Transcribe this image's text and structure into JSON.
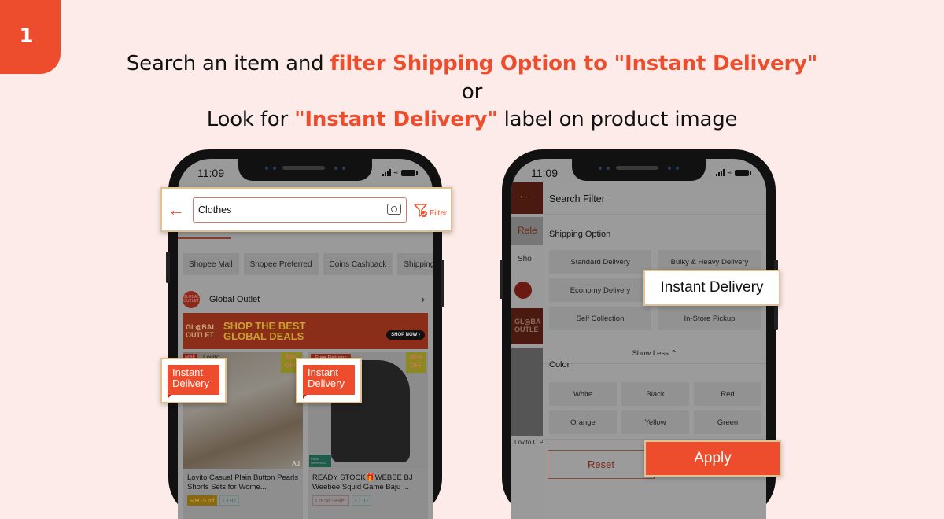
{
  "step": {
    "number": "1"
  },
  "headline": {
    "line1_a": "Search an item and ",
    "line1_b": "filter Shipping Option to \"Instant Delivery\"",
    "line2": "or",
    "line3_a": "Look for ",
    "line3_b": "\"Instant Delivery\"",
    "line3_c": " label on product image"
  },
  "colors": {
    "accent": "#ee4d2d",
    "background": "#fcebe8",
    "highlight_border": "#e1c193"
  },
  "left_phone": {
    "status": {
      "time": "11:09"
    },
    "search": {
      "back_icon": "arrow-left-icon",
      "value": "Clothes",
      "camera_icon": "camera-icon",
      "filter_label": "Filter"
    },
    "chips": [
      "Shopee Mall",
      "Shopee Preferred",
      "Coins Cashback",
      "Shipping O"
    ],
    "outlet": {
      "logo": "GLOBAL OUTLET",
      "name": "Global Outlet"
    },
    "banner": {
      "logo": "GL◎BAL OUTLET",
      "line1": "SHOP THE BEST",
      "line2": "GLOBAL DEALS",
      "cta": "SHOP NOW ›"
    },
    "products": [
      {
        "badge": "Mall",
        "brand": "Lovito",
        "discount": "35% OFF",
        "label": "Instant Delivery",
        "ad": "Ad",
        "title": "Lovito Casual Plain Button Pearls Shorts Sets for Wome...",
        "tags": [
          "RM15 off",
          "COD"
        ]
      },
      {
        "badge": "Free Returns",
        "discount": "85% OFF",
        "label": "Instant Delivery",
        "shipping_badge": "FREE SHIPPING",
        "title": "READY STOCK🎁WEBEE BJ Weebee Squid Game Baju ...",
        "tags": [
          "Local Seller",
          "COD"
        ]
      }
    ]
  },
  "right_phone": {
    "status": {
      "time": "11:09"
    },
    "background_strip": {
      "tab": "Rele",
      "chip": "Sho",
      "banner": "GL◎BA OUTLE",
      "title": "Lovito C Pearls S"
    },
    "filter": {
      "title": "Search Filter",
      "shipping_section": "Shipping Option",
      "shipping_options": [
        "Standard Delivery",
        "Bulky & Heavy Delivery",
        "Economy Delivery",
        "Instant Delivery",
        "Self Collection",
        "In-Store Pickup"
      ],
      "show_less": "Show Less ⌃",
      "color_section": "Color",
      "colors": [
        "White",
        "Black",
        "Red",
        "Orange",
        "Yellow",
        "Green"
      ],
      "reset": "Reset",
      "apply": "Apply"
    }
  }
}
